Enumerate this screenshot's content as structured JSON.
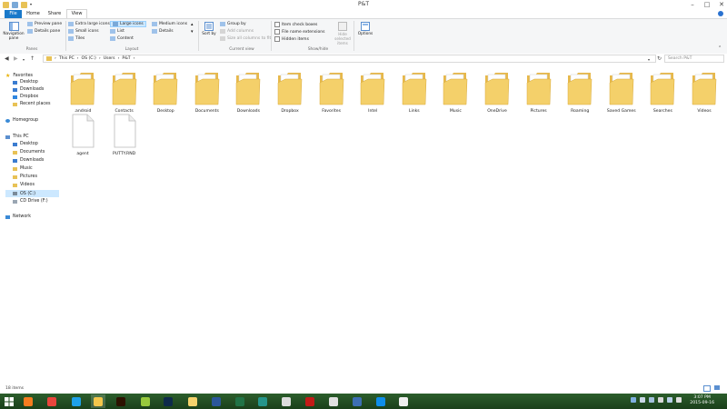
{
  "window": {
    "title": "P&T"
  },
  "tabs": {
    "file": "File",
    "home": "Home",
    "share": "Share",
    "view": "View"
  },
  "ribbon": {
    "panes": {
      "navigation_pane": "Navigation pane",
      "preview_pane": "Preview pane",
      "details_pane": "Details pane",
      "group": "Panes"
    },
    "layout": {
      "extra_large": "Extra large icons",
      "large": "Large icons",
      "medium": "Medium icons",
      "small": "Small icons",
      "list": "List",
      "details": "Details",
      "tiles": "Tiles",
      "content": "Content",
      "group": "Layout"
    },
    "current_view": {
      "sort_by": "Sort by",
      "group_by": "Group by",
      "add_columns": "Add columns",
      "size_all_columns": "Size all columns to fit",
      "group": "Current view"
    },
    "show_hide": {
      "item_checkboxes": "Item check boxes",
      "file_name_extensions": "File name extensions",
      "hidden_items": "Hidden items",
      "hide_selected": "Hide selected items",
      "group": "Show/hide"
    },
    "options": "Options"
  },
  "address": {
    "crumbs": [
      "This PC",
      "OS (C:)",
      "Users",
      "P&T"
    ],
    "search_placeholder": "Search P&T"
  },
  "nav": {
    "favorites": "Favorites",
    "fav_items": [
      "Desktop",
      "Downloads",
      "Dropbox",
      "Recent places"
    ],
    "homegroup": "Homegroup",
    "this_pc": "This PC",
    "pc_items": [
      "Desktop",
      "Documents",
      "Downloads",
      "Music",
      "Pictures",
      "Videos",
      "OS (C:)",
      "CD Drive (F:)"
    ],
    "network": "Network"
  },
  "items": [
    {
      "name": ".android",
      "icon": "folder-files-icon"
    },
    {
      "name": "Contacts",
      "icon": "folder-contacts-icon"
    },
    {
      "name": "Desktop",
      "icon": "folder-desktop-icon"
    },
    {
      "name": "Documents",
      "icon": "folder-documents-icon"
    },
    {
      "name": "Downloads",
      "icon": "folder-downloads-icon"
    },
    {
      "name": "Dropbox",
      "icon": "folder-dropbox-icon"
    },
    {
      "name": "Favorites",
      "icon": "folder-favorites-icon"
    },
    {
      "name": "Intel",
      "icon": "folder-icon"
    },
    {
      "name": "Links",
      "icon": "folder-links-icon"
    },
    {
      "name": "Music",
      "icon": "folder-music-icon"
    },
    {
      "name": "OneDrive",
      "icon": "folder-onedrive-icon"
    },
    {
      "name": "Pictures",
      "icon": "folder-pictures-icon"
    },
    {
      "name": "Roaming",
      "icon": "folder-icon"
    },
    {
      "name": "Saved Games",
      "icon": "folder-saved-games-icon"
    },
    {
      "name": "Searches",
      "icon": "folder-searches-icon"
    },
    {
      "name": "Videos",
      "icon": "folder-videos-icon"
    },
    {
      "name": "agent",
      "icon": "file-icon"
    },
    {
      "name": "PUTTY.RND",
      "icon": "file-icon"
    }
  ],
  "status": {
    "count": "18 items"
  },
  "taskbar": {
    "apps": [
      {
        "name": "firefox-app",
        "color": "#f57c1f"
      },
      {
        "name": "chrome-app",
        "color": "#e8453c"
      },
      {
        "name": "ie-app",
        "color": "#1ea1e8"
      },
      {
        "name": "explorer-app",
        "color": "#f3c64b"
      },
      {
        "name": "illustrator-app",
        "color": "#2c1200"
      },
      {
        "name": "dreamweaver-app",
        "color": "#97c93d"
      },
      {
        "name": "photoshop-app",
        "color": "#0d2a4a"
      },
      {
        "name": "outlook-app",
        "color": "#f4d26c"
      },
      {
        "name": "word-app",
        "color": "#2b579a"
      },
      {
        "name": "excel-app",
        "color": "#217346"
      },
      {
        "name": "publisher-app",
        "color": "#25958a"
      },
      {
        "name": "notepad-app",
        "color": "#dcdcdc"
      },
      {
        "name": "filezilla-app",
        "color": "#c21b17"
      },
      {
        "name": "app-14",
        "color": "#e0e0e0"
      },
      {
        "name": "app-15",
        "color": "#3d6fb3"
      },
      {
        "name": "teamviewer-app",
        "color": "#0e8ee9"
      },
      {
        "name": "app-17",
        "color": "#efefef"
      }
    ],
    "time": "3:07 PM",
    "date": "2015-09-16"
  }
}
